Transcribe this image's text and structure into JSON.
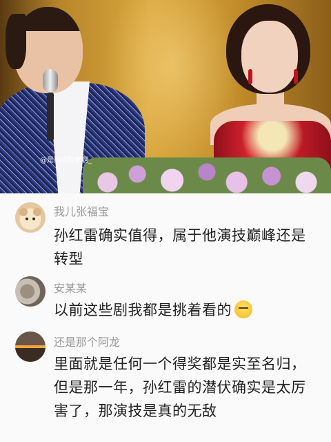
{
  "video": {
    "watermark": "@是阿局阿手啊_"
  },
  "comments": [
    {
      "username": "我儿张福宝",
      "text": "孙红雷确实值得，属于他演技巅峰还是转型",
      "avatar": "dog-avatar"
    },
    {
      "username": "安某某",
      "text": "以前这些剧我都是挑着看的",
      "emoji": "sleepy-face-emoji",
      "avatar": "cat-avatar"
    },
    {
      "username": "还是那个阿龙",
      "text": "里面就是任何一个得奖都是实至名归，但是那一年，孙红雷的潜伏确实是太厉害了，那演技是真的无敌",
      "avatar": "sunset-avatar"
    }
  ],
  "colors": {
    "username": "#9a9a9a",
    "text": "#222222",
    "background": "#fafafa"
  }
}
